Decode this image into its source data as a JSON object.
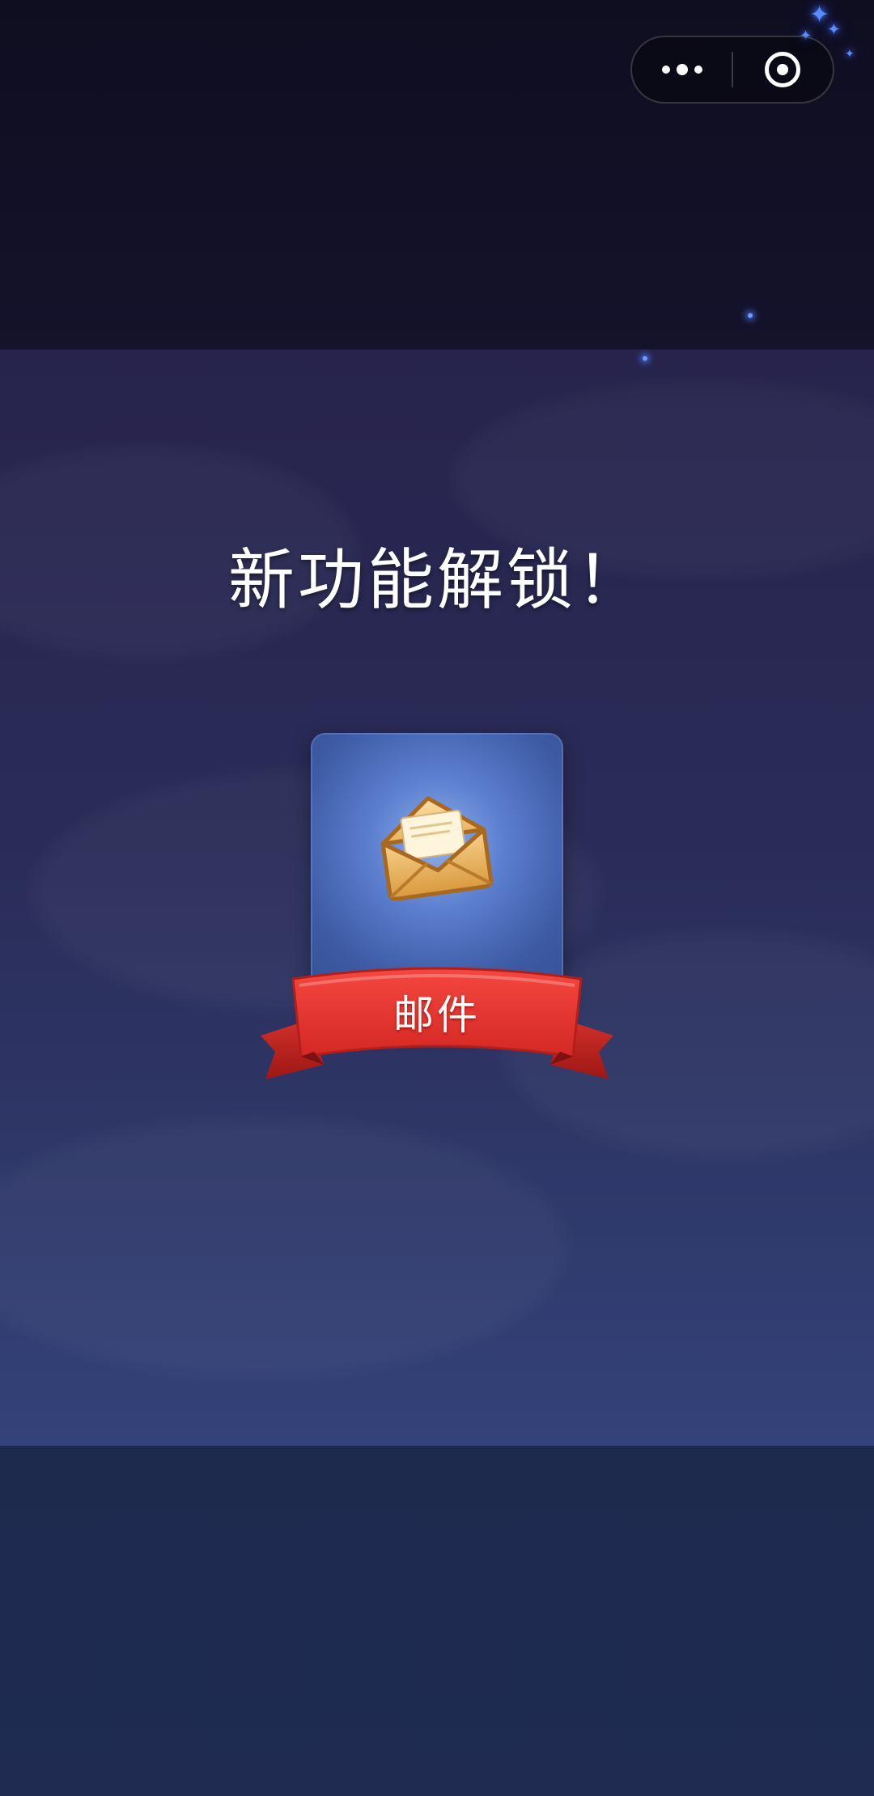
{
  "header": {
    "menu_icon": "more-dots-icon",
    "close_icon": "target-circle-icon"
  },
  "unlock": {
    "title": "新功能解锁！",
    "feature_label": "邮件",
    "feature_icon": "envelope-icon"
  },
  "colors": {
    "ribbon": "#e8312f",
    "card": "#4a67b5",
    "title_text": "#ffffff"
  }
}
